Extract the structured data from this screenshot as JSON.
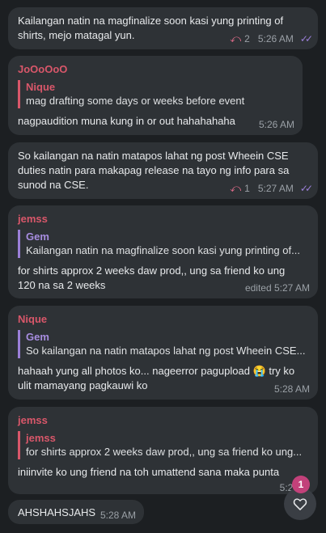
{
  "colors": {
    "background": "#1c1f22",
    "bubble": "#2e3236",
    "name_jooooo": "#d9576a",
    "name_nique": "#d9576a",
    "name_jemss": "#d9576a",
    "reply_bar_red": "#d9576a",
    "reply_bar_purple": "#9b7fd8",
    "reply_name_purple": "#a78de0",
    "badge": "#c2417a"
  },
  "messages": [
    {
      "text_lines": [
        "Kailangan natin na magfinalize soon kasi yung printing of",
        "shirts, mejo matagal yun."
      ],
      "reply_count": "2",
      "time": "5:26 AM",
      "read": true
    },
    {
      "sender": "JoOoOoO",
      "quote_name": "Nique",
      "quote_text": "mag drafting some days or weeks before event",
      "text_lines": [
        "nagpaudition muna kung in or out hahahahaha"
      ],
      "time": "5:26 AM"
    },
    {
      "text_lines": [
        "So kailangan na natin matapos lahat ng post Wheein CSE",
        "duties natin para makapag release na tayo ng info para sa",
        "sunod na CSE."
      ],
      "reply_count": "1",
      "time": "5:27 AM",
      "read": true
    },
    {
      "sender": "jemss",
      "quote_name": "Gem",
      "quote_text": "Kailangan natin na magfinalize soon kasi yung printing of...",
      "text_lines": [
        "for shirts approx 2 weeks daw prod,, ung sa friend ko ung",
        "120 na sa 2 weeks"
      ],
      "time": "edited 5:27 AM"
    },
    {
      "sender": "Nique",
      "quote_name": "Gem",
      "quote_text": "So kailangan na natin matapos lahat ng post Wheein CSE...",
      "text_lines": [
        "hahaah yung all photos ko... nageerror pagupload 😭 try ko",
        "ulit mamayang pagkauwi ko"
      ],
      "time": "5:28 AM"
    },
    {
      "sender": "jemss",
      "quote_name": "jemss",
      "quote_text": "for shirts approx 2 weeks daw prod,, ung sa friend ko ung...",
      "text_lines": [
        "iniinvite ko ung friend na toh umattend sana maka punta"
      ],
      "time": "5:28"
    },
    {
      "text_lines": [
        "AHSHAHSJAHS"
      ],
      "time": "5:28 AM"
    }
  ],
  "reaction_badge": "1"
}
